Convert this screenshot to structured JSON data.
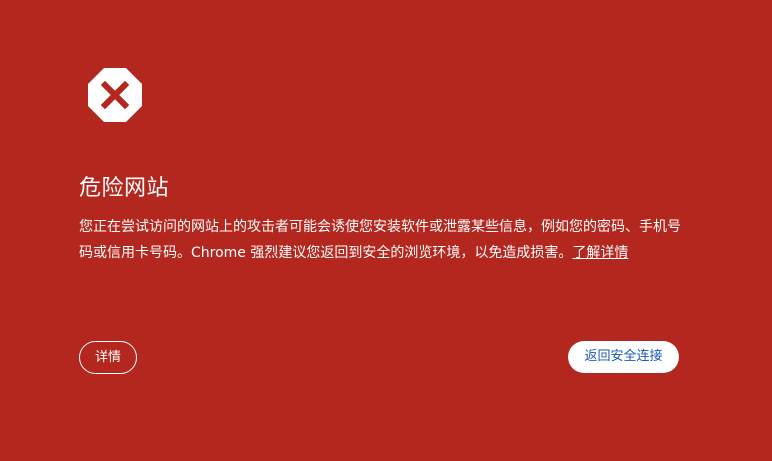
{
  "interstitial": {
    "icon": "danger-stop-sign-icon",
    "title": "危险网站",
    "message": "您正在尝试访问的网站上的攻击者可能会诱使您安装软件或泄露某些信息，例如您的密码、手机号码或信用卡号码。Chrome 强烈建议您返回到安全的浏览环境，以免造成损害。",
    "learn_more_label": "了解详情",
    "details_button_label": "详情",
    "back_to_safety_button_label": "返回安全连接"
  },
  "colors": {
    "background": "#b3271f",
    "text": "#ffffff",
    "icon_fill": "#ffffff",
    "icon_mark": "#b3271f",
    "primary_button_bg": "#ffffff",
    "primary_button_text": "#1a57b7"
  }
}
